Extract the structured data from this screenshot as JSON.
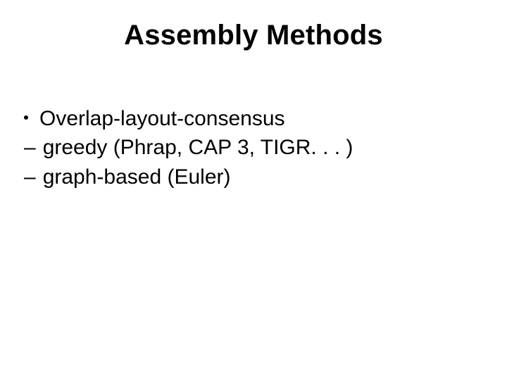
{
  "title": "Assembly Methods",
  "bullets": {
    "item1": "Overlap-layout-consensus",
    "sub1_dash": "–",
    "sub1": "greedy (Phrap, CAP 3, TIGR. . . )",
    "sub2_dash": "–",
    "sub2": "graph-based (Euler)"
  }
}
